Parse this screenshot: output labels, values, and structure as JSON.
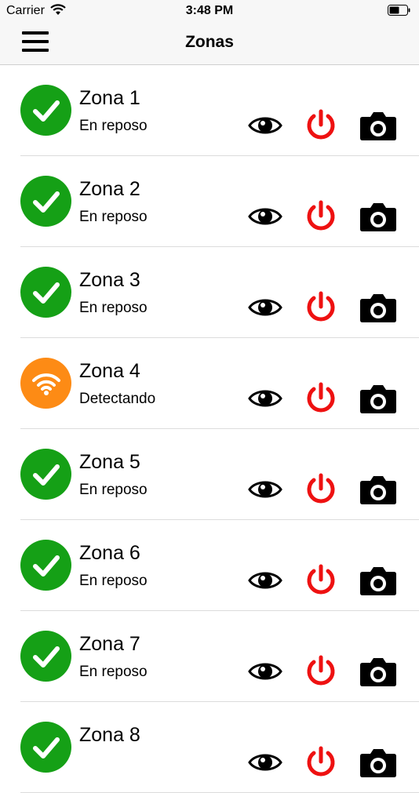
{
  "status_bar": {
    "carrier": "Carrier",
    "time": "3:48 PM"
  },
  "navbar": {
    "title": "Zonas",
    "menu_icon": "hamburger-menu-icon"
  },
  "colors": {
    "ok": "#15a016",
    "detecting": "#fd8b15",
    "power": "#ee1111",
    "icon": "#000000"
  },
  "zones": [
    {
      "name": "Zona 1",
      "status": "En reposo",
      "state": "ok"
    },
    {
      "name": "Zona 2",
      "status": "En reposo",
      "state": "ok"
    },
    {
      "name": "Zona 3",
      "status": "En reposo",
      "state": "ok"
    },
    {
      "name": "Zona 4",
      "status": "Detectando",
      "state": "detecting"
    },
    {
      "name": "Zona 5",
      "status": "En reposo",
      "state": "ok"
    },
    {
      "name": "Zona 6",
      "status": "En reposo",
      "state": "ok"
    },
    {
      "name": "Zona 7",
      "status": "En reposo",
      "state": "ok"
    },
    {
      "name": "Zona 8",
      "status": "",
      "state": "ok"
    }
  ],
  "row_actions": [
    "eye-icon",
    "power-icon",
    "camera-icon"
  ]
}
